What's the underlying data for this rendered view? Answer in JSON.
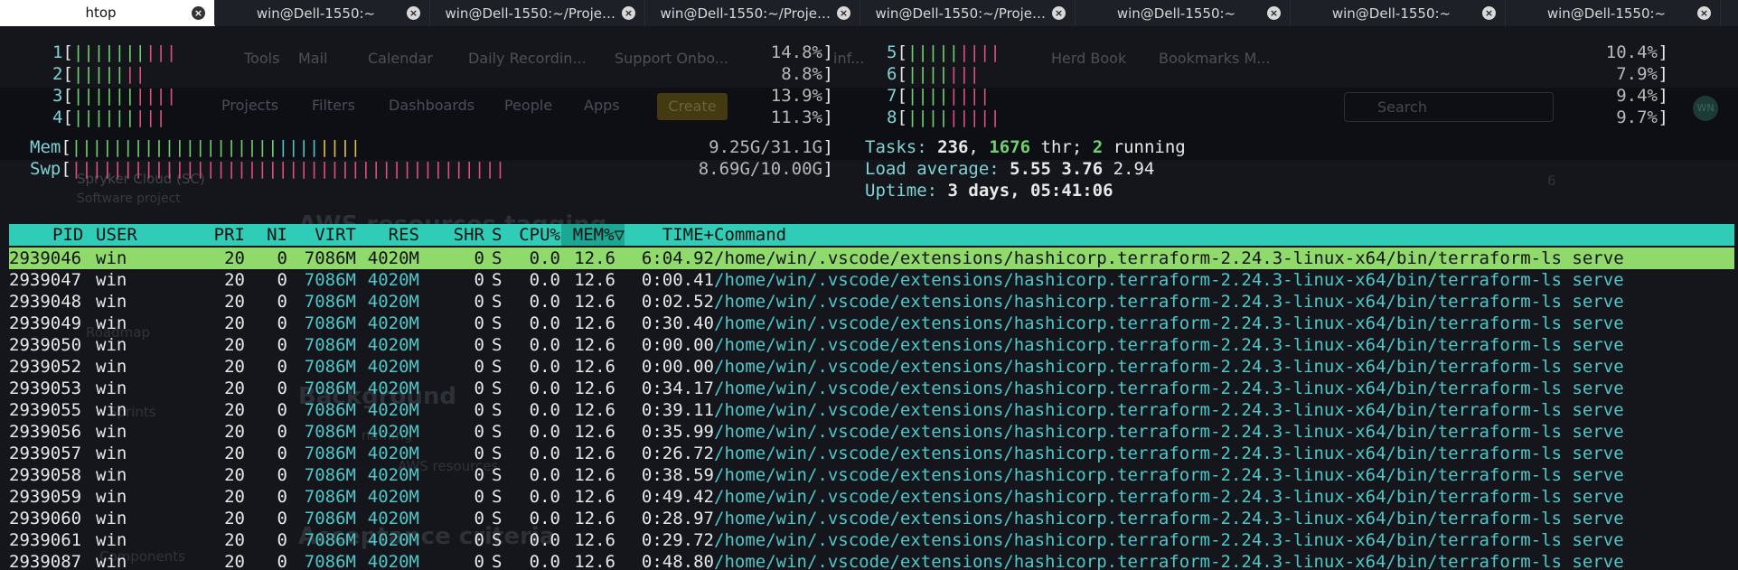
{
  "tabs": [
    {
      "label": "htop",
      "active": true
    },
    {
      "label": "win@Dell-1550:~",
      "active": false
    },
    {
      "label": "win@Dell-1550:~/Project...",
      "active": false
    },
    {
      "label": "win@Dell-1550:~/Project...",
      "active": false
    },
    {
      "label": "win@Dell-1550:~/Project...",
      "active": false
    },
    {
      "label": "win@Dell-1550:~",
      "active": false
    },
    {
      "label": "win@Dell-1550:~",
      "active": false
    },
    {
      "label": "win@Dell-1550:~",
      "active": false
    }
  ],
  "background": {
    "bookmarks": [
      "Tools",
      "Mail",
      "Calendar",
      "Daily Recordin...",
      "Support Onbo...",
      "inf...",
      "Herd Book",
      "Bookmarks M..."
    ],
    "nav": [
      "Projects",
      "Filters",
      "Dashboards",
      "People",
      "Apps"
    ],
    "create_label": "Create",
    "search_placeholder": "Search",
    "avatar_initials": "WN",
    "project_name": "Spryker Cloud (SC)",
    "project_type": "Software project",
    "ghost_heading_1": "AWS resources tagging",
    "ghost_heading_2": "Background",
    "ghost_heading_3": "Acceptance criteria",
    "ghost_text_1": "naming",
    "ghost_text_2": "AWS resources",
    "ghost_side_1": "Roadmap",
    "ghost_side_2": "Sprints",
    "ghost_side_3": "Components",
    "watch_count": "6"
  },
  "htop": {
    "cpus": [
      {
        "num": "1",
        "pct": "14.8%",
        "green": 7,
        "red": 3
      },
      {
        "num": "2",
        "pct": "8.8%",
        "green": 5,
        "red": 2
      },
      {
        "num": "3",
        "pct": "13.9%",
        "green": 6,
        "red": 4
      },
      {
        "num": "4",
        "pct": "11.3%",
        "green": 6,
        "red": 3
      },
      {
        "num": "5",
        "pct": "10.4%",
        "green": 5,
        "red": 4
      },
      {
        "num": "6",
        "pct": "7.9%",
        "green": 4,
        "red": 3
      },
      {
        "num": "7",
        "pct": "9.4%",
        "green": 4,
        "red": 4
      },
      {
        "num": "8",
        "pct": "9.7%",
        "green": 4,
        "red": 5
      }
    ],
    "mem": {
      "label": "Mem",
      "value": "9.25G/31.1G",
      "green": 20,
      "cyan": 4,
      "yellow": 4
    },
    "swp": {
      "label": "Swp",
      "value": "8.69G/10.00G",
      "red": 42
    },
    "tasks": {
      "label": "Tasks:",
      "tasks": "236",
      "sep1": ",",
      "threads": "1676",
      "thr_label": "thr;",
      "running": "2",
      "running_label": "running"
    },
    "load": {
      "label": "Load average:",
      "l1": "5.55",
      "l5": "3.76",
      "l15": "2.94"
    },
    "uptime": {
      "label": "Uptime:",
      "value": "3 days, 05:41:06"
    },
    "columns": {
      "pid": "PID",
      "user": "USER",
      "pri": "PRI",
      "ni": "NI",
      "virt": "VIRT",
      "res": "RES",
      "shr": "SHR",
      "s": "S",
      "cpu": "CPU%",
      "mem": "MEM%▽",
      "time": "TIME+",
      "cmd": "Command"
    },
    "processes": [
      {
        "pid": "2939046",
        "user": "win",
        "pri": "20",
        "ni": "0",
        "virt": "7086M",
        "res": "4020M",
        "shr": "0",
        "s": "S",
        "cpu": "0.0",
        "mem": "12.6",
        "time": "6:04.92",
        "cmd": "/home/win/.vscode/extensions/hashicorp.terraform-2.24.3-linux-x64/bin/terraform-ls serve",
        "selected": true
      },
      {
        "pid": "2939047",
        "user": "win",
        "pri": "20",
        "ni": "0",
        "virt": "7086M",
        "res": "4020M",
        "shr": "0",
        "s": "S",
        "cpu": "0.0",
        "mem": "12.6",
        "time": "0:00.41",
        "cmd": "/home/win/.vscode/extensions/hashicorp.terraform-2.24.3-linux-x64/bin/terraform-ls serve"
      },
      {
        "pid": "2939048",
        "user": "win",
        "pri": "20",
        "ni": "0",
        "virt": "7086M",
        "res": "4020M",
        "shr": "0",
        "s": "S",
        "cpu": "0.0",
        "mem": "12.6",
        "time": "0:02.52",
        "cmd": "/home/win/.vscode/extensions/hashicorp.terraform-2.24.3-linux-x64/bin/terraform-ls serve"
      },
      {
        "pid": "2939049",
        "user": "win",
        "pri": "20",
        "ni": "0",
        "virt": "7086M",
        "res": "4020M",
        "shr": "0",
        "s": "S",
        "cpu": "0.0",
        "mem": "12.6",
        "time": "0:30.40",
        "cmd": "/home/win/.vscode/extensions/hashicorp.terraform-2.24.3-linux-x64/bin/terraform-ls serve"
      },
      {
        "pid": "2939050",
        "user": "win",
        "pri": "20",
        "ni": "0",
        "virt": "7086M",
        "res": "4020M",
        "shr": "0",
        "s": "S",
        "cpu": "0.0",
        "mem": "12.6",
        "time": "0:00.00",
        "cmd": "/home/win/.vscode/extensions/hashicorp.terraform-2.24.3-linux-x64/bin/terraform-ls serve"
      },
      {
        "pid": "2939052",
        "user": "win",
        "pri": "20",
        "ni": "0",
        "virt": "7086M",
        "res": "4020M",
        "shr": "0",
        "s": "S",
        "cpu": "0.0",
        "mem": "12.6",
        "time": "0:00.00",
        "cmd": "/home/win/.vscode/extensions/hashicorp.terraform-2.24.3-linux-x64/bin/terraform-ls serve"
      },
      {
        "pid": "2939053",
        "user": "win",
        "pri": "20",
        "ni": "0",
        "virt": "7086M",
        "res": "4020M",
        "shr": "0",
        "s": "S",
        "cpu": "0.0",
        "mem": "12.6",
        "time": "0:34.17",
        "cmd": "/home/win/.vscode/extensions/hashicorp.terraform-2.24.3-linux-x64/bin/terraform-ls serve"
      },
      {
        "pid": "2939055",
        "user": "win",
        "pri": "20",
        "ni": "0",
        "virt": "7086M",
        "res": "4020M",
        "shr": "0",
        "s": "S",
        "cpu": "0.0",
        "mem": "12.6",
        "time": "0:39.11",
        "cmd": "/home/win/.vscode/extensions/hashicorp.terraform-2.24.3-linux-x64/bin/terraform-ls serve"
      },
      {
        "pid": "2939056",
        "user": "win",
        "pri": "20",
        "ni": "0",
        "virt": "7086M",
        "res": "4020M",
        "shr": "0",
        "s": "S",
        "cpu": "0.0",
        "mem": "12.6",
        "time": "0:35.99",
        "cmd": "/home/win/.vscode/extensions/hashicorp.terraform-2.24.3-linux-x64/bin/terraform-ls serve"
      },
      {
        "pid": "2939057",
        "user": "win",
        "pri": "20",
        "ni": "0",
        "virt": "7086M",
        "res": "4020M",
        "shr": "0",
        "s": "S",
        "cpu": "0.0",
        "mem": "12.6",
        "time": "0:26.72",
        "cmd": "/home/win/.vscode/extensions/hashicorp.terraform-2.24.3-linux-x64/bin/terraform-ls serve"
      },
      {
        "pid": "2939058",
        "user": "win",
        "pri": "20",
        "ni": "0",
        "virt": "7086M",
        "res": "4020M",
        "shr": "0",
        "s": "S",
        "cpu": "0.0",
        "mem": "12.6",
        "time": "0:38.59",
        "cmd": "/home/win/.vscode/extensions/hashicorp.terraform-2.24.3-linux-x64/bin/terraform-ls serve"
      },
      {
        "pid": "2939059",
        "user": "win",
        "pri": "20",
        "ni": "0",
        "virt": "7086M",
        "res": "4020M",
        "shr": "0",
        "s": "S",
        "cpu": "0.0",
        "mem": "12.6",
        "time": "0:49.42",
        "cmd": "/home/win/.vscode/extensions/hashicorp.terraform-2.24.3-linux-x64/bin/terraform-ls serve"
      },
      {
        "pid": "2939060",
        "user": "win",
        "pri": "20",
        "ni": "0",
        "virt": "7086M",
        "res": "4020M",
        "shr": "0",
        "s": "S",
        "cpu": "0.0",
        "mem": "12.6",
        "time": "0:28.97",
        "cmd": "/home/win/.vscode/extensions/hashicorp.terraform-2.24.3-linux-x64/bin/terraform-ls serve"
      },
      {
        "pid": "2939061",
        "user": "win",
        "pri": "20",
        "ni": "0",
        "virt": "7086M",
        "res": "4020M",
        "shr": "0",
        "s": "S",
        "cpu": "0.0",
        "mem": "12.6",
        "time": "0:29.72",
        "cmd": "/home/win/.vscode/extensions/hashicorp.terraform-2.24.3-linux-x64/bin/terraform-ls serve"
      },
      {
        "pid": "2939087",
        "user": "win",
        "pri": "20",
        "ni": "0",
        "virt": "7086M",
        "res": "4020M",
        "shr": "0",
        "s": "S",
        "cpu": "0.0",
        "mem": "12.6",
        "time": "0:48.80",
        "cmd": "/home/win/.vscode/extensions/hashicorp.terraform-2.24.3-linux-x64/bin/terraform-ls serve"
      }
    ]
  },
  "colors": {
    "header_bg": "#2fcdb7",
    "selected_row_bg": "#8fda6a",
    "bar_green": "#6fd06f",
    "bar_red": "#e0507a",
    "cyan": "#4ec7c9"
  }
}
